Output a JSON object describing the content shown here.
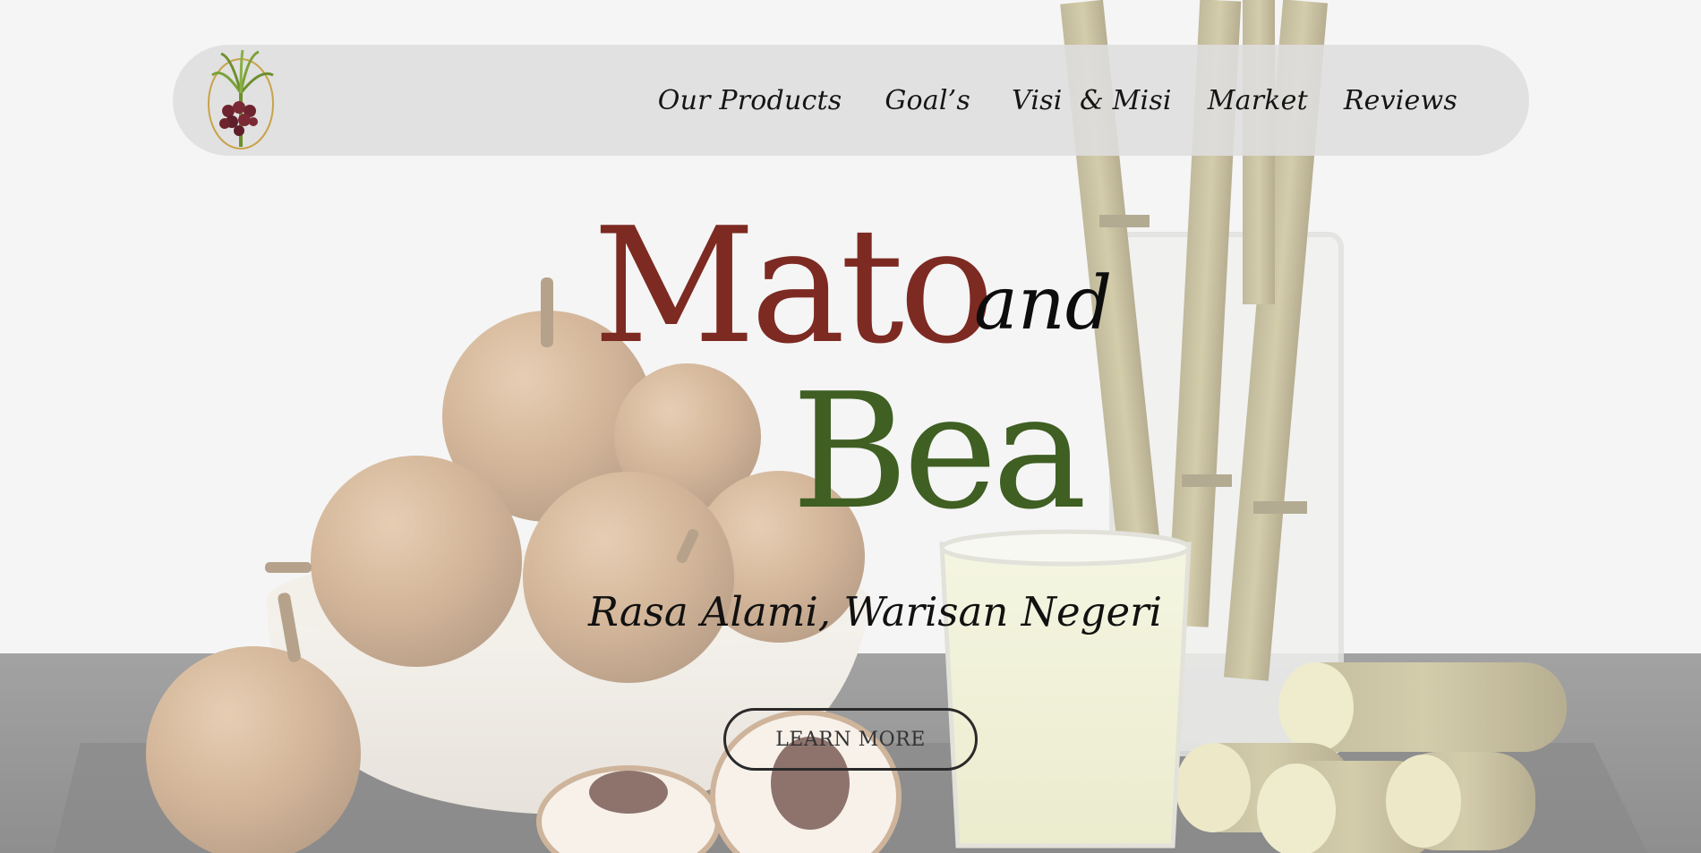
{
  "brand": {
    "logo_icon": "sugarcane-fruit-logo-icon"
  },
  "nav": {
    "items": [
      {
        "label": "Our Products"
      },
      {
        "label": "Goal’s"
      },
      {
        "label": "Visi  & Misi"
      },
      {
        "label": "Market"
      },
      {
        "label": "Reviews"
      }
    ]
  },
  "hero": {
    "title_word_1": "Mato",
    "connector": "and",
    "title_word_2": "Bea",
    "tagline": "Rasa Alami, Warisan Negeri",
    "cta_label": "LEARN MORE"
  },
  "colors": {
    "title_red": "#7d2a22",
    "title_green": "#3f5f23",
    "navbar_bg": "#dedede",
    "text_dark": "#111111"
  }
}
